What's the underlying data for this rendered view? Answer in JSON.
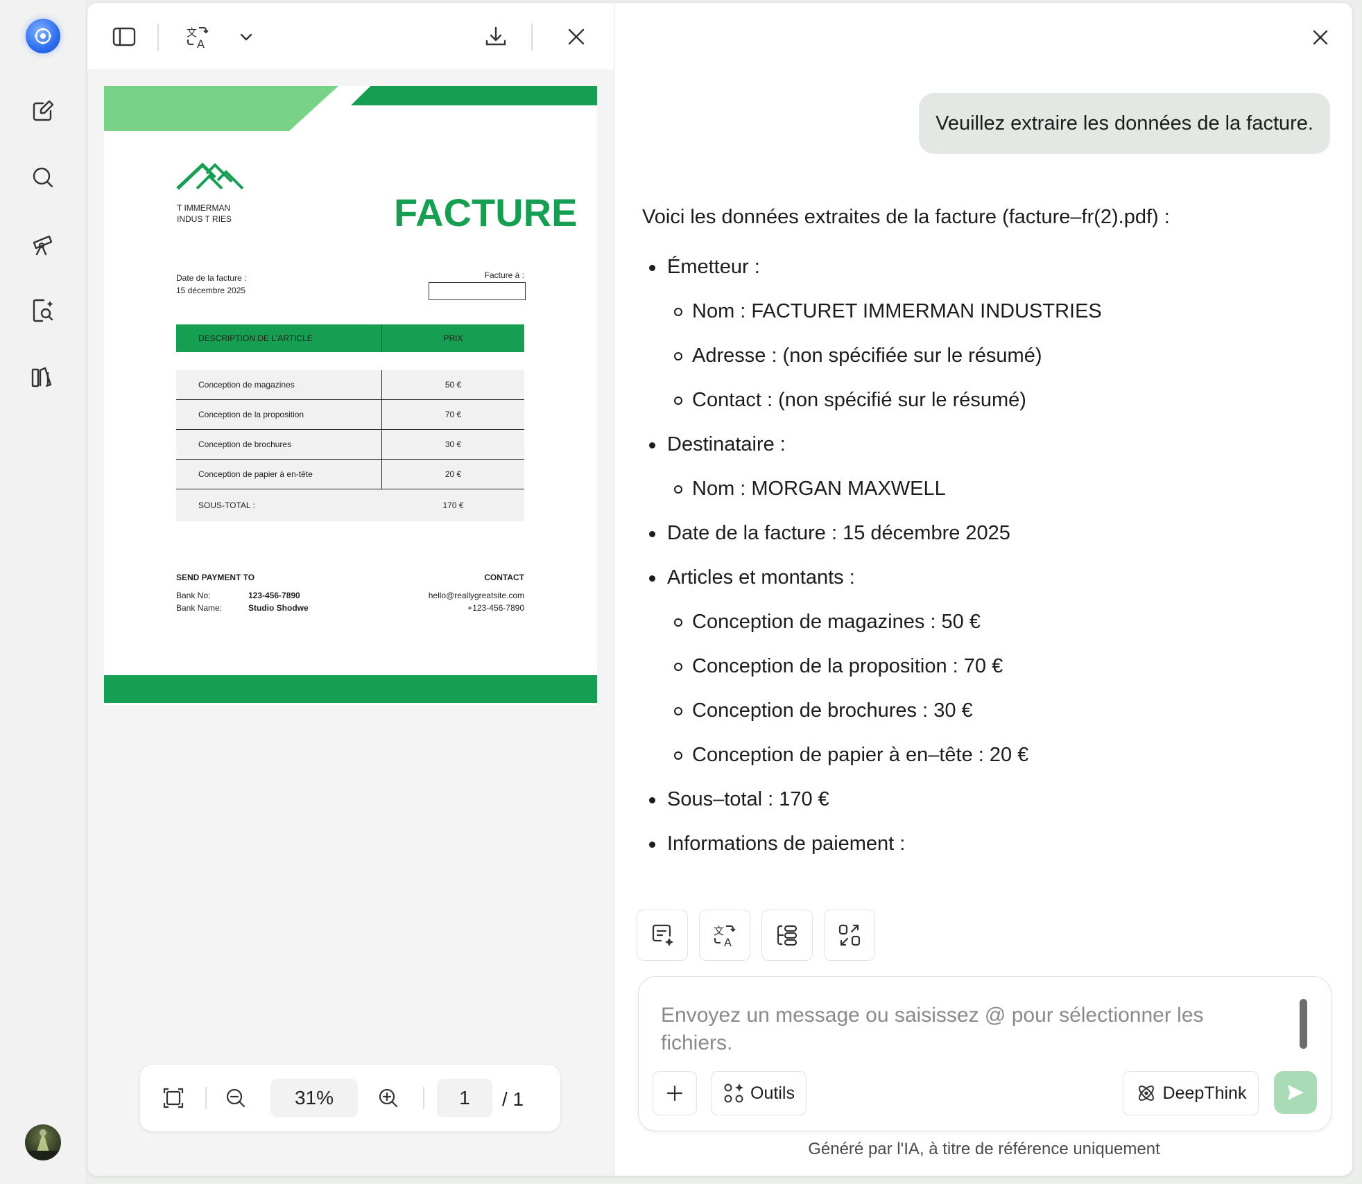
{
  "sidebar": {
    "icons": [
      "app-logo",
      "new-chat-icon",
      "search-icon",
      "telescope-icon",
      "document-search-icon",
      "library-icon"
    ],
    "accent": "#2d6cf0"
  },
  "toolbar": {
    "icons": [
      "sidebar-toggle-icon",
      "translate-icon",
      "chevron-down-icon",
      "download-icon",
      "close-icon"
    ]
  },
  "document": {
    "company_line1": "T   IMMERMAN",
    "company_line2": "INDUS T RIES",
    "title": "FACTURE",
    "date_label": "Date de la facture :",
    "date_value": "15 décembre 2025",
    "bill_to_label": "Facture à :",
    "table_headers": [
      "DESCRIPTION DE L'ARTICLE",
      "PRIX"
    ],
    "rows": [
      {
        "desc": "Conception de magazines",
        "price": "50 €"
      },
      {
        "desc": "Conception de la proposition",
        "price": "70 €"
      },
      {
        "desc": "Conception de brochures",
        "price": "30 €"
      },
      {
        "desc": "Conception de papier à en-tête",
        "price": "20 €"
      }
    ],
    "subtotal_label": "SOUS-TOTAL :",
    "subtotal_value": "170 €",
    "payment_title": "SEND PAYMENT TO",
    "bank_no_label": "Bank No:",
    "bank_no_value": "123-456-7890",
    "bank_name_label": "Bank Name:",
    "bank_name_value": "Studio Shodwe",
    "contact_title": "CONTACT",
    "contact_email": "hello@reallygreatsite.com",
    "contact_phone": "+123-456-7890",
    "brand_green": "#169e52",
    "light_green": "#78d386"
  },
  "zoom": {
    "value": "31%",
    "page": "1",
    "total": "/ 1"
  },
  "chat": {
    "user_message": "Veuillez extraire les données de la facture.",
    "intro": "Voici les données extraites de la facture (facture–fr(2).pdf) :",
    "items": [
      {
        "type": "bullet",
        "text": "Émetteur :"
      },
      {
        "type": "sub",
        "text": "Nom : FACTURET IMMERMAN INDUSTRIES"
      },
      {
        "type": "sub",
        "text": "Adresse : (non spécifiée sur le résumé)"
      },
      {
        "type": "sub",
        "text": "Contact : (non spécifié sur le résumé)"
      },
      {
        "type": "bullet",
        "text": "Destinataire :"
      },
      {
        "type": "sub",
        "text": "Nom : MORGAN MAXWELL"
      },
      {
        "type": "bullet",
        "text": "Date de la facture : 15 décembre 2025"
      },
      {
        "type": "bullet",
        "text": "Articles et montants :"
      },
      {
        "type": "sub",
        "text": "Conception de magazines : 50 €"
      },
      {
        "type": "sub",
        "text": "Conception de la proposition : 70 €"
      },
      {
        "type": "sub",
        "text": "Conception de brochures : 30 €"
      },
      {
        "type": "sub",
        "text": "Conception de papier à en–tête : 20 €"
      },
      {
        "type": "bullet",
        "text": "Sous–total : 170 €"
      },
      {
        "type": "bullet",
        "text": "Informations de paiement :"
      }
    ],
    "quick_actions": [
      "summary-icon",
      "translate-icon",
      "mindmap-icon",
      "convert-icon"
    ],
    "input_placeholder": "Envoyez un message ou saisissez @ pour sélectionner les fichiers.",
    "tools_label": "Outils",
    "deepthink_label": "DeepThink",
    "footer": "Généré par l'IA, à titre de référence uniquement",
    "send_color": "#a9dbb7"
  }
}
